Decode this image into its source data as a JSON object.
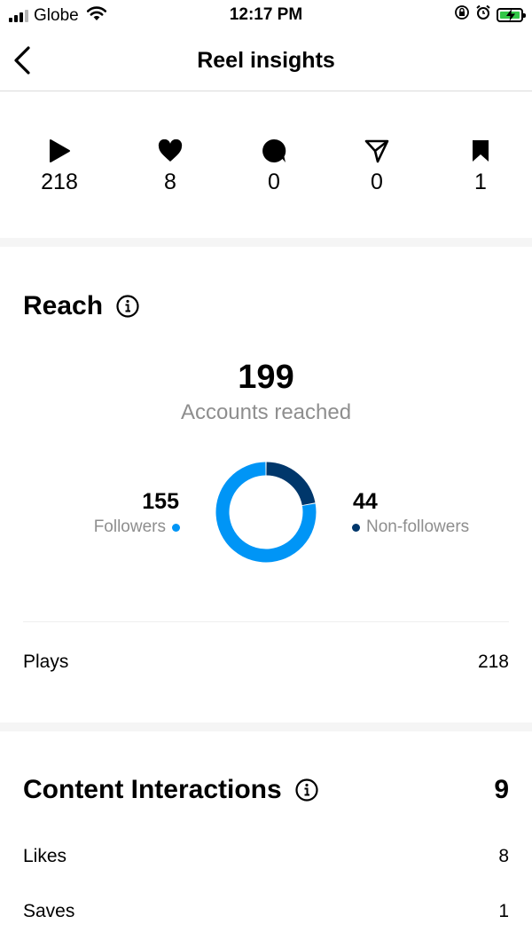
{
  "status_bar": {
    "carrier": "Globe",
    "time": "12:17 PM"
  },
  "header": {
    "title": "Reel insights"
  },
  "metrics": [
    {
      "icon": "play-icon",
      "value": "218"
    },
    {
      "icon": "heart-icon",
      "value": "8"
    },
    {
      "icon": "comment-icon",
      "value": "0"
    },
    {
      "icon": "share-icon",
      "value": "0"
    },
    {
      "icon": "save-icon",
      "value": "1"
    }
  ],
  "reach": {
    "title": "Reach",
    "accounts_reached": "199",
    "accounts_reached_label": "Accounts reached",
    "followers_value": "155",
    "followers_label": "Followers",
    "non_followers_value": "44",
    "non_followers_label": "Non-followers",
    "plays_label": "Plays",
    "plays_value": "218"
  },
  "chart_data": {
    "type": "pie",
    "categories": [
      "Followers",
      "Non-followers"
    ],
    "values": [
      155,
      44
    ],
    "colors": [
      "#0095f6",
      "#00376b"
    ]
  },
  "content_interactions": {
    "title": "Content Interactions",
    "total": "9",
    "rows": [
      {
        "label": "Likes",
        "value": "8"
      },
      {
        "label": "Saves",
        "value": "1"
      }
    ]
  }
}
